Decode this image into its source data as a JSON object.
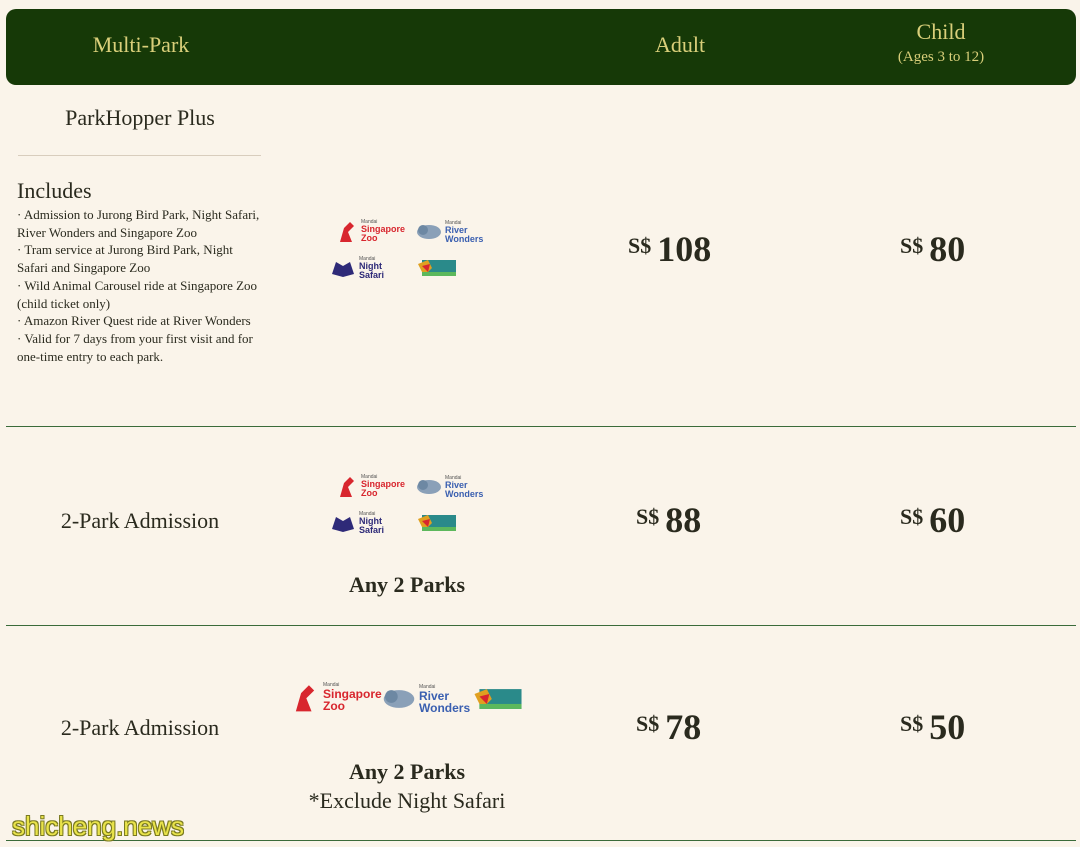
{
  "header": {
    "col_multi": "Multi-Park",
    "col_adult": "Adult",
    "col_child": "Child",
    "col_child_sub": "(Ages 3 to 12)"
  },
  "rows": [
    {
      "name": "ParkHopper Plus",
      "includes_heading": "Includes",
      "includes": [
        "· Admission to Jurong Bird Park, Night Safari, River Wonders and Singapore Zoo",
        "· Tram service at Jurong Bird Park, Night Safari and Singapore Zoo",
        "· Wild Animal Carousel ride at Singapore Zoo (child ticket only)",
        "· Amazon River Quest ride at River Wonders",
        "· Valid for 7 days from your first visit and for one-time entry to each park."
      ],
      "adult_currency": "S$",
      "adult_price": "108",
      "child_currency": "S$",
      "child_price": "80"
    },
    {
      "name": "2-Park Admission",
      "note": "Any 2 Parks",
      "adult_currency": "S$",
      "adult_price": "88",
      "child_currency": "S$",
      "child_price": "60"
    },
    {
      "name": "2-Park Admission",
      "note": "Any 2 Parks",
      "note2": "*Exclude Night Safari",
      "adult_currency": "S$",
      "adult_price": "78",
      "child_currency": "S$",
      "child_price": "50"
    }
  ],
  "logos": {
    "brand": "Mandai",
    "zoo": [
      "Singapore",
      "Zoo"
    ],
    "river": [
      "River",
      "Wonders"
    ],
    "night": [
      "Night",
      "Safari"
    ],
    "bird": "BIRD PARK",
    "zoo_color": "#d8262e",
    "river_color": "#3a5fb0",
    "night_color": "#2e2a78",
    "bird_color": "#2a8a8a"
  },
  "watermark": "shicheng.news",
  "colors": {
    "header_bg": "#163907",
    "header_text": "#d9cf7a",
    "background": "#faf4ea",
    "row_rule": "#3a6b3a"
  }
}
